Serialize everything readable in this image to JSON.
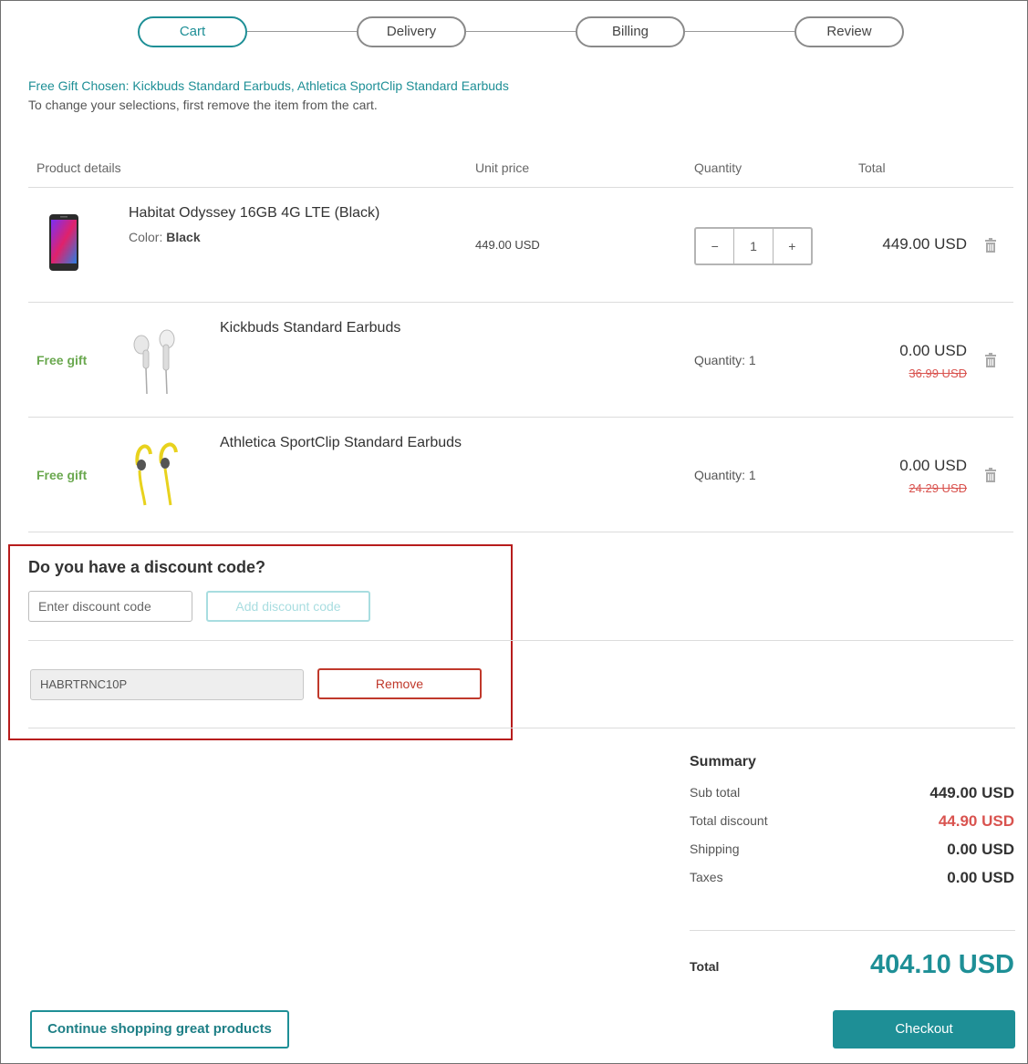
{
  "steps": [
    {
      "label": "Cart",
      "active": true
    },
    {
      "label": "Delivery",
      "active": false
    },
    {
      "label": "Billing",
      "active": false
    },
    {
      "label": "Review",
      "active": false
    }
  ],
  "gift_note": {
    "chosen": "Free Gift Chosen: Kickbuds Standard Earbuds, Athletica SportClip Standard Earbuds",
    "instruction": "To change your selections, first remove the item from the cart."
  },
  "table": {
    "headers": {
      "product": "Product details",
      "unit_price": "Unit price",
      "quantity": "Quantity",
      "total": "Total"
    }
  },
  "items": [
    {
      "name": "Habitat Odyssey 16GB 4G LTE (Black)",
      "color_label": "Color:",
      "color_value": "Black",
      "unit_price": "449.00 USD",
      "quantity": "1",
      "minus": "−",
      "plus": "+",
      "total": "449.00 USD"
    },
    {
      "tag": "Free gift",
      "name": "Kickbuds Standard Earbuds",
      "quantity_text": "Quantity: 1",
      "total": "0.00 USD",
      "original": "36.99 USD"
    },
    {
      "tag": "Free gift",
      "name": "Athletica SportClip Standard Earbuds",
      "quantity_text": "Quantity: 1",
      "total": "0.00 USD",
      "original": "24.29 USD"
    }
  ],
  "discount": {
    "title": "Do you have a discount code?",
    "placeholder": "Enter discount code",
    "add_label": "Add discount code",
    "applied_code": "HABRTRNC10P",
    "remove_label": "Remove"
  },
  "summary": {
    "title": "Summary",
    "subtotal_label": "Sub total",
    "subtotal": "449.00 USD",
    "discount_label": "Total discount",
    "discount": "44.90 USD",
    "shipping_label": "Shipping",
    "shipping": "0.00 USD",
    "taxes_label": "Taxes",
    "taxes": "0.00 USD",
    "total_label": "Total",
    "total": "404.10 USD"
  },
  "actions": {
    "continue_label": "Continue shopping great products",
    "checkout_label": "Checkout"
  },
  "colors": {
    "accent": "#1e8f96",
    "free_gift": "#6aa84f",
    "discount_red": "#d9534f",
    "highlight_border": "#b71c1c"
  },
  "icons": [
    "trash-icon",
    "phone-image",
    "earbuds-white-image",
    "earbuds-yellow-image"
  ]
}
